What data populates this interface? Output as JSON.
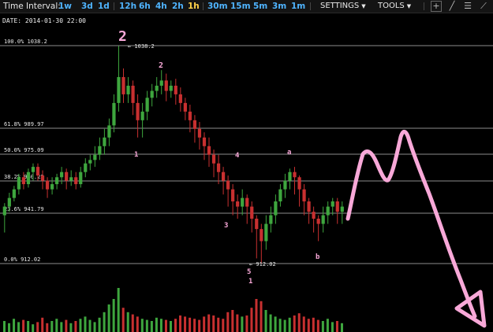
{
  "toolbar": {
    "time_interval_label": "Time Interval:",
    "intervals": [
      "1w",
      "3d",
      "1d",
      "12h",
      "6h",
      "4h",
      "2h",
      "1h",
      "30m",
      "15m",
      "5m",
      "3m",
      "1m"
    ],
    "active_interval": "1h",
    "settings_label": "SETTINGS",
    "tools_label": "TOOLS"
  },
  "date_label": "DATE: 2014-01-30 22:00",
  "colors": {
    "up": "#3ea63e",
    "down": "#c83030",
    "annotation": "#f8a8d8",
    "fib_line": "#bdbdbd"
  },
  "chart_data": {
    "type": "candlestick",
    "fib_levels": [
      {
        "pct": "100.0%",
        "price": "1038.2"
      },
      {
        "pct": "61.8%",
        "price": "989.97"
      },
      {
        "pct": "50.0%",
        "price": "975.09"
      },
      {
        "pct": "38.2%",
        "price": "960.23"
      },
      {
        "pct": "23.6%",
        "price": "941.79"
      },
      {
        "pct": "0.0%",
        "price": "912.02"
      }
    ],
    "high_marker": "← 1038.2",
    "low_marker": "← 912.02",
    "wave_labels": [
      "2",
      "2",
      "1",
      "4",
      "a",
      "3",
      "5",
      "1",
      "b"
    ],
    "candles": [
      [
        940,
        945,
        930,
        947
      ],
      [
        945,
        950,
        942,
        953
      ],
      [
        950,
        955,
        948,
        957
      ],
      [
        955,
        962,
        952,
        964
      ],
      [
        962,
        958,
        955,
        965
      ],
      [
        958,
        965,
        956,
        967
      ],
      [
        965,
        968,
        960,
        970
      ],
      [
        968,
        963,
        960,
        970
      ],
      [
        963,
        960,
        955,
        966
      ],
      [
        960,
        955,
        950,
        962
      ],
      [
        955,
        958,
        952,
        962
      ],
      [
        958,
        962,
        955,
        964
      ],
      [
        962,
        965,
        958,
        968
      ],
      [
        965,
        960,
        955,
        967
      ],
      [
        960,
        962,
        957,
        966
      ],
      [
        962,
        958,
        955,
        965
      ],
      [
        958,
        965,
        956,
        968
      ],
      [
        965,
        970,
        962,
        973
      ],
      [
        970,
        972,
        966,
        975
      ],
      [
        972,
        975,
        968,
        980
      ],
      [
        975,
        980,
        972,
        985
      ],
      [
        980,
        985,
        975,
        990
      ],
      [
        985,
        992,
        980,
        996
      ],
      [
        992,
        1005,
        988,
        1010
      ],
      [
        1005,
        1020,
        1000,
        1038
      ],
      [
        1020,
        1010,
        1005,
        1025
      ],
      [
        1010,
        1015,
        1005,
        1020
      ],
      [
        1015,
        1005,
        998,
        1018
      ],
      [
        1005,
        995,
        985,
        1010
      ],
      [
        995,
        1000,
        985,
        1005
      ],
      [
        1000,
        1008,
        995,
        1012
      ],
      [
        1008,
        1012,
        1003,
        1016
      ],
      [
        1012,
        1015,
        1008,
        1020
      ],
      [
        1015,
        1018,
        1010,
        1024
      ],
      [
        1018,
        1012,
        1006,
        1022
      ],
      [
        1012,
        1015,
        1008,
        1018
      ],
      [
        1015,
        1010,
        1004,
        1019
      ],
      [
        1010,
        1005,
        1000,
        1014
      ],
      [
        1005,
        1000,
        995,
        1008
      ],
      [
        1000,
        995,
        988,
        1004
      ],
      [
        995,
        990,
        982,
        998
      ],
      [
        990,
        985,
        978,
        994
      ],
      [
        985,
        980,
        972,
        988
      ],
      [
        980,
        975,
        968,
        985
      ],
      [
        975,
        970,
        962,
        978
      ],
      [
        970,
        965,
        958,
        975
      ],
      [
        965,
        960,
        952,
        968
      ],
      [
        960,
        955,
        945,
        963
      ],
      [
        955,
        948,
        940,
        958
      ],
      [
        948,
        945,
        938,
        952
      ],
      [
        945,
        950,
        940,
        955
      ],
      [
        950,
        945,
        935,
        952
      ],
      [
        945,
        938,
        930,
        948
      ],
      [
        938,
        932,
        915,
        940
      ],
      [
        932,
        925,
        912,
        935
      ],
      [
        925,
        935,
        920,
        940
      ],
      [
        935,
        940,
        930,
        945
      ],
      [
        940,
        948,
        935,
        952
      ],
      [
        948,
        955,
        945,
        958
      ],
      [
        955,
        960,
        950,
        964
      ],
      [
        960,
        965,
        955,
        967
      ],
      [
        965,
        962,
        952,
        968
      ],
      [
        962,
        955,
        945,
        963
      ],
      [
        955,
        948,
        940,
        958
      ],
      [
        948,
        942,
        935,
        950
      ],
      [
        942,
        938,
        930,
        945
      ],
      [
        938,
        935,
        925,
        940
      ],
      [
        935,
        940,
        930,
        945
      ],
      [
        940,
        945,
        935,
        948
      ],
      [
        945,
        948,
        940,
        950
      ],
      [
        948,
        942,
        935,
        950
      ],
      [
        942,
        945,
        935,
        948
      ]
    ],
    "volume": [
      10,
      8,
      12,
      9,
      11,
      10,
      7,
      9,
      13,
      8,
      10,
      12,
      9,
      11,
      8,
      10,
      12,
      14,
      11,
      9,
      13,
      18,
      25,
      30,
      40,
      22,
      18,
      16,
      14,
      12,
      11,
      10,
      13,
      12,
      11,
      10,
      12,
      15,
      14,
      13,
      12,
      11,
      14,
      16,
      15,
      13,
      12,
      18,
      20,
      16,
      14,
      15,
      22,
      30,
      28,
      20,
      16,
      14,
      12,
      11,
      13,
      15,
      17,
      14,
      12,
      13,
      11,
      10,
      12,
      9,
      10,
      8
    ]
  }
}
